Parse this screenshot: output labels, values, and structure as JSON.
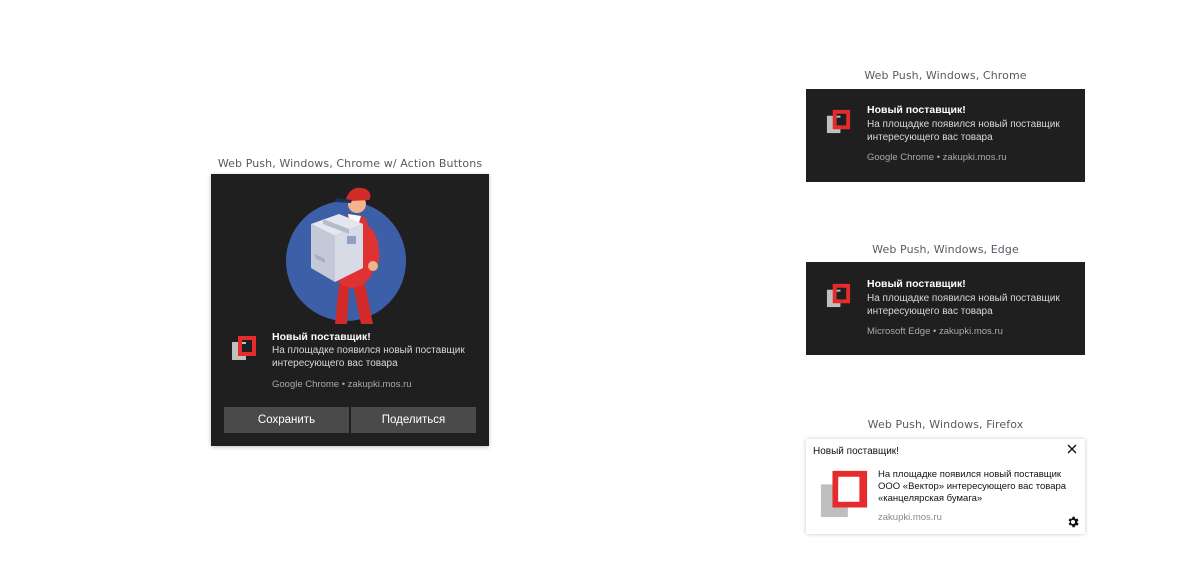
{
  "captions": {
    "chrome_actions": "Web Push, Windows, Chrome w/ Action Buttons",
    "chrome": "Web Push, Windows, Chrome",
    "edge": "Web Push, Windows, Edge",
    "firefox": "Web Push, Windows, Firefox"
  },
  "chrome_actions": {
    "title": "Новый поставщик!",
    "body": "На площадке появился новый поставщик интересующего вас товара",
    "source": "Google Chrome • zakupki.mos.ru",
    "actions": [
      "Сохранить",
      "Поделиться"
    ],
    "hero_icon": "courier-with-box-illustration"
  },
  "chrome": {
    "title": "Новый поставщик!",
    "body": "На площадке появился новый поставщик интересующего вас товара",
    "source": "Google Chrome • zakupki.mos.ru"
  },
  "edge": {
    "title": "Новый поставщик!",
    "body": "На площадке появился новый поставщик интересующего вас товара",
    "source": "Microsoft Edge • zakupki.mos.ru"
  },
  "firefox": {
    "title": "Новый поставщик!",
    "body": "На площадке появился новый поставщик ООО «Вектор» интересующего вас товара «канцелярская бумага»",
    "source": "zakupki.mos.ru",
    "close_icon": "close-icon",
    "settings_icon": "gear-icon"
  },
  "colors": {
    "notification_bg": "#1f1f1f",
    "button_bg": "#4a4a4a",
    "brand_red": "#e52b2b",
    "brand_gray": "#bfbfbf",
    "hero_circle": "#3d5fa8"
  }
}
